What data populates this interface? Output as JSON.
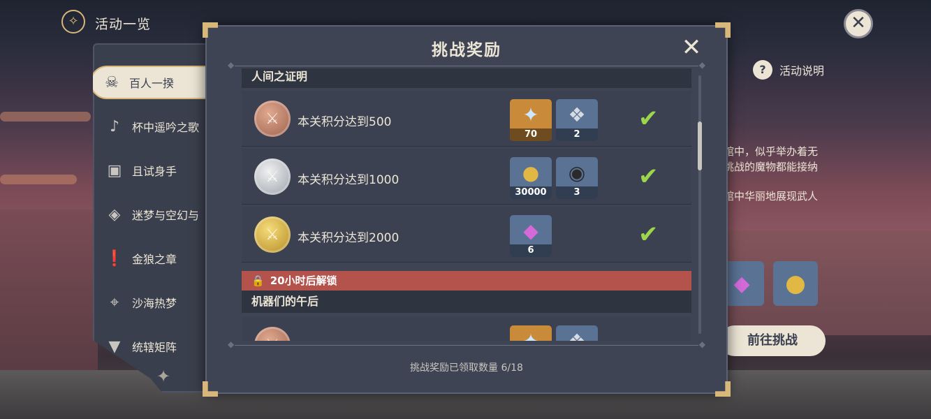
{
  "header": {
    "title": "活动一览",
    "icon": "compass-icon"
  },
  "sidebar": {
    "items": [
      {
        "label": "百人一揆",
        "icon": "oni-mask-icon",
        "active": true
      },
      {
        "label": "杯中遥吟之歌",
        "icon": "bell-icon",
        "active": false
      },
      {
        "label": "且试身手",
        "icon": "cards-icon",
        "active": false
      },
      {
        "label": "迷梦与空幻与",
        "icon": "diamond-warning-icon",
        "active": false
      },
      {
        "label": "金狼之章",
        "icon": "warning-icon",
        "active": false
      },
      {
        "label": "沙海热梦",
        "icon": "location-pin-icon",
        "active": false
      },
      {
        "label": "统辖矩阵",
        "icon": "shield-v-icon",
        "active": false
      }
    ]
  },
  "event_panel": {
    "help_label": "活动说明",
    "description_lines": [
      "馆中，似乎举办着无",
      "挑战的魔物都能接纳",
      "馆中华丽地展现武人"
    ],
    "go_button": "前往挑战"
  },
  "modal": {
    "title": "挑战奖励",
    "footer": "挑战奖励已领取数量 6/18",
    "sections": [
      {
        "title": "人间之证明",
        "rows": [
          {
            "medal": "bronze",
            "label": "本关积分达到500",
            "claimed": true,
            "rewards": [
              {
                "item": "primogem",
                "qty": "70",
                "color": "#c98a3a"
              },
              {
                "item": "hero-wit",
                "qty": "2",
                "color": "#5a7294"
              }
            ]
          },
          {
            "medal": "silver",
            "label": "本关积分达到1000",
            "claimed": true,
            "rewards": [
              {
                "item": "mora",
                "qty": "30000",
                "color": "#5a7294"
              },
              {
                "item": "ore",
                "qty": "3",
                "color": "#5a7294"
              }
            ]
          },
          {
            "medal": "gold",
            "label": "本关积分达到2000",
            "claimed": true,
            "rewards": [
              {
                "item": "crystal",
                "qty": "6",
                "color": "#5a7294"
              }
            ]
          }
        ]
      },
      {
        "locked_label": "20小时后解锁",
        "title": "机器们的午后"
      }
    ]
  },
  "colors": {
    "panel": "#3e4453",
    "accent_gold": "#d8b77a",
    "check_green": "#9cd64a",
    "lock_red": "#b4534b",
    "cream": "#ece5d6"
  }
}
